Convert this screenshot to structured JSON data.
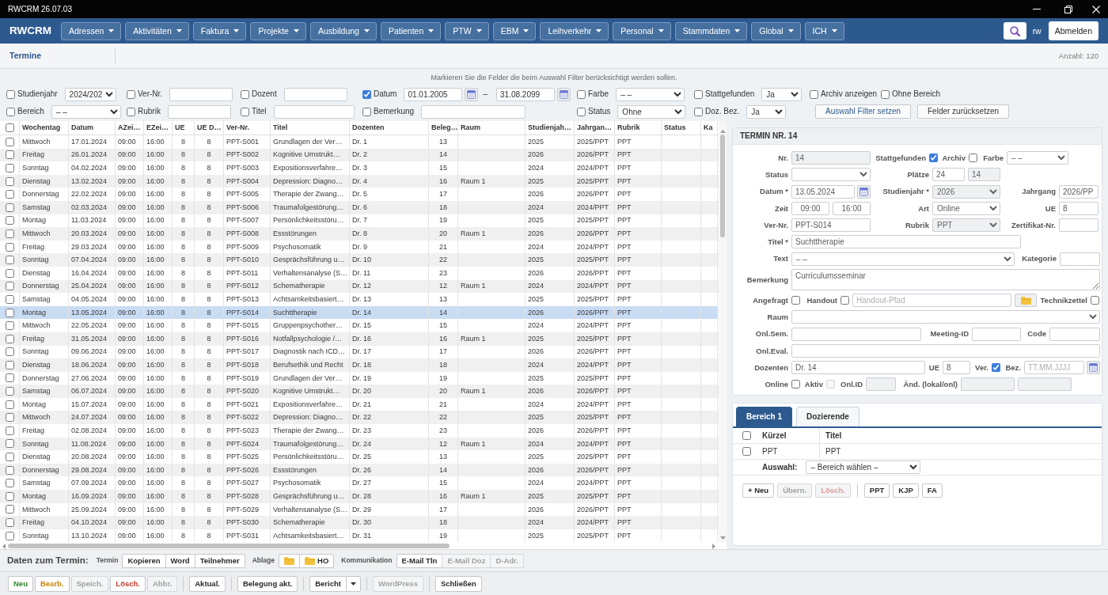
{
  "window": {
    "title": "RWCRM 26.07.03"
  },
  "navbar": {
    "brand": "RWCRM",
    "menus": [
      "Adressen",
      "Aktivitäten",
      "Faktura",
      "Projekte",
      "Ausbildung",
      "Patienten",
      "PTW",
      "EBM",
      "Leihverkehr",
      "Personal",
      "Stammdaten",
      "Global",
      "ICH"
    ],
    "user": "rw",
    "logout": "Abmelden"
  },
  "page": {
    "title": "Termine",
    "count": "Anzahl: 120"
  },
  "filter": {
    "hint": "Markieren Sie die Felder die beim Auswahl Filter berücksichtigt werden sollen.",
    "rows": [
      [
        {
          "kind": "select",
          "label": "Studienjahr",
          "checked": false,
          "value": "2024/202"
        },
        {
          "kind": "input",
          "label": "Ver-Nr.",
          "checked": false
        },
        {
          "kind": "input",
          "label": "Dozent",
          "checked": false
        },
        {
          "kind": "date_range",
          "label": "Datum",
          "checked": true,
          "from": "01.01.2005",
          "separator": "–",
          "to": "31.08.2099"
        },
        {
          "kind": "select",
          "label": "Farbe",
          "checked": false,
          "value": "– –"
        },
        {
          "kind": "select",
          "label": "Stattgefunden",
          "checked": false,
          "value": "Ja"
        },
        {
          "kind": "check",
          "label": "Archiv anzeigen",
          "checked": false
        },
        {
          "kind": "check",
          "label": "Ohne Bereich",
          "checked": false
        }
      ],
      [
        {
          "kind": "select",
          "label": "Bereich",
          "checked": false,
          "value": "– –"
        },
        {
          "kind": "input",
          "label": "Rubrik",
          "checked": false
        },
        {
          "kind": "input",
          "label": "Titel",
          "checked": false
        },
        {
          "kind": "input",
          "label": "Bemerkung",
          "checked": false
        },
        {
          "kind": "select",
          "label": "Status",
          "checked": false,
          "value": "Ohne"
        },
        {
          "kind": "select",
          "label": "Doz. Bez.",
          "checked": false,
          "value": "Ja"
        },
        {
          "kind": "button",
          "label": "Auswahl Filter setzen",
          "primary": true
        },
        {
          "kind": "button",
          "label": "Felder zurücksetzen",
          "primary": false
        }
      ]
    ]
  },
  "table": {
    "all_checked": false,
    "columns": [
      "Wochentag",
      "Datum",
      "AZei…",
      "EZei…",
      "UE",
      "UE D…",
      "Ver-Nr.",
      "Titel",
      "Dozenten",
      "Beleg…",
      "Raum",
      "Studienjah…",
      "Jahrgan…",
      "Rubrik",
      "Status",
      "Ka"
    ],
    "rows": [
      {
        "checked": false,
        "selected": false,
        "weekday": "Mittwoch",
        "date": "17.01.2024",
        "start": "09:00",
        "end": "16:00",
        "ue": "8",
        "ue_d": "8",
        "number": "PPT-S001",
        "title": "Grundlagen der Ver…",
        "lecturer": "Dr. 1",
        "booked": "13",
        "study_year": "2025",
        "cohort": "2025/PPT",
        "rubric": "PPT"
      },
      {
        "checked": false,
        "selected": false,
        "weekday": "Freitag",
        "date": "26.01.2024",
        "start": "09:00",
        "end": "16:00",
        "ue": "8",
        "ue_d": "8",
        "number": "PPT-S002",
        "title": "Kognitive Umstrukt…",
        "lecturer": "Dr. 2",
        "booked": "14",
        "study_year": "2026",
        "cohort": "2026/PPT",
        "rubric": "PPT"
      },
      {
        "checked": false,
        "selected": false,
        "weekday": "Sonntag",
        "date": "04.02.2024",
        "start": "09:00",
        "end": "16:00",
        "ue": "8",
        "ue_d": "8",
        "number": "PPT-S003",
        "title": "Expositionsverfahre…",
        "lecturer": "Dr. 3",
        "booked": "15",
        "study_year": "2024",
        "cohort": "2024/PPT",
        "rubric": "PPT"
      },
      {
        "checked": false,
        "selected": false,
        "weekday": "Dienstag",
        "date": "13.02.2024",
        "start": "09:00",
        "end": "16:00",
        "ue": "8",
        "ue_d": "8",
        "number": "PPT-S004",
        "title": "Depression: Diagno…",
        "lecturer": "Dr. 4",
        "booked": "16",
        "room": "Raum 1",
        "study_year": "2025",
        "cohort": "2025/PPT",
        "rubric": "PPT"
      },
      {
        "checked": false,
        "selected": false,
        "weekday": "Donnerstag",
        "date": "22.02.2024",
        "start": "09:00",
        "end": "16:00",
        "ue": "8",
        "ue_d": "8",
        "number": "PPT-S005",
        "title": "Therapie der Zwang…",
        "lecturer": "Dr. 5",
        "booked": "17",
        "study_year": "2026",
        "cohort": "2026/PPT",
        "rubric": "PPT"
      },
      {
        "checked": false,
        "selected": false,
        "weekday": "Samstag",
        "date": "02.03.2024",
        "start": "09:00",
        "end": "16:00",
        "ue": "8",
        "ue_d": "8",
        "number": "PPT-S006",
        "title": "Traumafolgestörung…",
        "lecturer": "Dr. 6",
        "booked": "18",
        "study_year": "2024",
        "cohort": "2024/PPT",
        "rubric": "PPT"
      },
      {
        "checked": false,
        "selected": false,
        "weekday": "Montag",
        "date": "11.03.2024",
        "start": "09:00",
        "end": "16:00",
        "ue": "8",
        "ue_d": "8",
        "number": "PPT-S007",
        "title": "Persönlichkeitsstöru…",
        "lecturer": "Dr. 7",
        "booked": "19",
        "study_year": "2025",
        "cohort": "2025/PPT",
        "rubric": "PPT"
      },
      {
        "checked": false,
        "selected": false,
        "weekday": "Mittwoch",
        "date": "20.03.2024",
        "start": "09:00",
        "end": "16:00",
        "ue": "8",
        "ue_d": "8",
        "number": "PPT-S008",
        "title": "Essstörungen",
        "lecturer": "Dr. 8",
        "booked": "20",
        "room": "Raum 1",
        "study_year": "2026",
        "cohort": "2026/PPT",
        "rubric": "PPT"
      },
      {
        "checked": false,
        "selected": false,
        "weekday": "Freitag",
        "date": "29.03.2024",
        "start": "09:00",
        "end": "16:00",
        "ue": "8",
        "ue_d": "8",
        "number": "PPT-S009",
        "title": "Psychosomatik",
        "lecturer": "Dr. 9",
        "booked": "21",
        "study_year": "2024",
        "cohort": "2024/PPT",
        "rubric": "PPT"
      },
      {
        "checked": false,
        "selected": false,
        "weekday": "Sonntag",
        "date": "07.04.2024",
        "start": "09:00",
        "end": "16:00",
        "ue": "8",
        "ue_d": "8",
        "number": "PPT-S010",
        "title": "Gesprächsführung u…",
        "lecturer": "Dr. 10",
        "booked": "22",
        "study_year": "2025",
        "cohort": "2025/PPT",
        "rubric": "PPT"
      },
      {
        "checked": false,
        "selected": false,
        "weekday": "Dienstag",
        "date": "16.04.2024",
        "start": "09:00",
        "end": "16:00",
        "ue": "8",
        "ue_d": "8",
        "number": "PPT-S011",
        "title": "Verhaltensanalyse (S…",
        "lecturer": "Dr. 11",
        "booked": "23",
        "study_year": "2026",
        "cohort": "2026/PPT",
        "rubric": "PPT"
      },
      {
        "checked": false,
        "selected": false,
        "weekday": "Donnerstag",
        "date": "25.04.2024",
        "start": "09:00",
        "end": "16:00",
        "ue": "8",
        "ue_d": "8",
        "number": "PPT-S012",
        "title": "Schematherapie",
        "lecturer": "Dr. 12",
        "booked": "12",
        "room": "Raum 1",
        "study_year": "2024",
        "cohort": "2024/PPT",
        "rubric": "PPT"
      },
      {
        "checked": false,
        "selected": false,
        "weekday": "Samstag",
        "date": "04.05.2024",
        "start": "09:00",
        "end": "16:00",
        "ue": "8",
        "ue_d": "8",
        "number": "PPT-S013",
        "title": "Achtsamkeitsbasiert…",
        "lecturer": "Dr. 13",
        "booked": "13",
        "study_year": "2025",
        "cohort": "2025/PPT",
        "rubric": "PPT"
      },
      {
        "checked": false,
        "selected": true,
        "weekday": "Montag",
        "date": "13.05.2024",
        "start": "09:00",
        "end": "16:00",
        "ue": "8",
        "ue_d": "8",
        "number": "PPT-S014",
        "title": "Suchttherapie",
        "lecturer": "Dr. 14",
        "booked": "14",
        "study_year": "2026",
        "cohort": "2026/PPT",
        "rubric": "PPT"
      },
      {
        "checked": false,
        "selected": false,
        "weekday": "Mittwoch",
        "date": "22.05.2024",
        "start": "09:00",
        "end": "16:00",
        "ue": "8",
        "ue_d": "8",
        "number": "PPT-S015",
        "title": "Gruppenpsychother…",
        "lecturer": "Dr. 15",
        "booked": "15",
        "study_year": "2024",
        "cohort": "2024/PPT",
        "rubric": "PPT"
      },
      {
        "checked": false,
        "selected": false,
        "weekday": "Freitag",
        "date": "31.05.2024",
        "start": "09:00",
        "end": "16:00",
        "ue": "8",
        "ue_d": "8",
        "number": "PPT-S016",
        "title": "Notfallpsychologie /…",
        "lecturer": "Dr. 16",
        "booked": "16",
        "room": "Raum 1",
        "study_year": "2025",
        "cohort": "2025/PPT",
        "rubric": "PPT"
      },
      {
        "checked": false,
        "selected": false,
        "weekday": "Sonntag",
        "date": "09.06.2024",
        "start": "09:00",
        "end": "16:00",
        "ue": "8",
        "ue_d": "8",
        "number": "PPT-S017",
        "title": "Diagnostik nach ICD…",
        "lecturer": "Dr. 17",
        "booked": "17",
        "study_year": "2026",
        "cohort": "2026/PPT",
        "rubric": "PPT"
      },
      {
        "checked": false,
        "selected": false,
        "weekday": "Dienstag",
        "date": "18.06.2024",
        "start": "09:00",
        "end": "16:00",
        "ue": "8",
        "ue_d": "8",
        "number": "PPT-S018",
        "title": "Berufsethik und Recht",
        "lecturer": "Dr. 18",
        "booked": "18",
        "study_year": "2024",
        "cohort": "2024/PPT",
        "rubric": "PPT"
      },
      {
        "checked": false,
        "selected": false,
        "weekday": "Donnerstag",
        "date": "27.06.2024",
        "start": "09:00",
        "end": "16:00",
        "ue": "8",
        "ue_d": "8",
        "number": "PPT-S019",
        "title": "Grundlagen der Ver…",
        "lecturer": "Dr. 19",
        "booked": "19",
        "study_year": "2025",
        "cohort": "2025/PPT",
        "rubric": "PPT"
      },
      {
        "checked": false,
        "selected": false,
        "weekday": "Samstag",
        "date": "06.07.2024",
        "start": "09:00",
        "end": "16:00",
        "ue": "8",
        "ue_d": "8",
        "number": "PPT-S020",
        "title": "Kognitive Umstrukt…",
        "lecturer": "Dr. 20",
        "booked": "20",
        "room": "Raum 1",
        "study_year": "2026",
        "cohort": "2026/PPT",
        "rubric": "PPT"
      },
      {
        "checked": false,
        "selected": false,
        "weekday": "Montag",
        "date": "15.07.2024",
        "start": "09:00",
        "end": "16:00",
        "ue": "8",
        "ue_d": "8",
        "number": "PPT-S021",
        "title": "Expositionsverfahre…",
        "lecturer": "Dr. 21",
        "booked": "21",
        "study_year": "2024",
        "cohort": "2024/PPT",
        "rubric": "PPT"
      },
      {
        "checked": false,
        "selected": false,
        "weekday": "Mittwoch",
        "date": "24.07.2024",
        "start": "09:00",
        "end": "16:00",
        "ue": "8",
        "ue_d": "8",
        "number": "PPT-S022",
        "title": "Depression: Diagno…",
        "lecturer": "Dr. 22",
        "booked": "22",
        "study_year": "2025",
        "cohort": "2025/PPT",
        "rubric": "PPT"
      },
      {
        "checked": false,
        "selected": false,
        "weekday": "Freitag",
        "date": "02.08.2024",
        "start": "09:00",
        "end": "16:00",
        "ue": "8",
        "ue_d": "8",
        "number": "PPT-S023",
        "title": "Therapie der Zwang…",
        "lecturer": "Dr. 23",
        "booked": "23",
        "study_year": "2026",
        "cohort": "2026/PPT",
        "rubric": "PPT"
      },
      {
        "checked": false,
        "selected": false,
        "weekday": "Sonntag",
        "date": "11.08.2024",
        "start": "09:00",
        "end": "16:00",
        "ue": "8",
        "ue_d": "8",
        "number": "PPT-S024",
        "title": "Traumafolgestörung…",
        "lecturer": "Dr. 24",
        "booked": "12",
        "room": "Raum 1",
        "study_year": "2024",
        "cohort": "2024/PPT",
        "rubric": "PPT"
      },
      {
        "checked": false,
        "selected": false,
        "weekday": "Dienstag",
        "date": "20.08.2024",
        "start": "09:00",
        "end": "16:00",
        "ue": "8",
        "ue_d": "8",
        "number": "PPT-S025",
        "title": "Persönlichkeitsstöru…",
        "lecturer": "Dr. 25",
        "booked": "13",
        "study_year": "2025",
        "cohort": "2025/PPT",
        "rubric": "PPT"
      },
      {
        "checked": false,
        "selected": false,
        "weekday": "Donnerstag",
        "date": "29.08.2024",
        "start": "09:00",
        "end": "16:00",
        "ue": "8",
        "ue_d": "8",
        "number": "PPT-S026",
        "title": "Essstörungen",
        "lecturer": "Dr. 26",
        "booked": "14",
        "study_year": "2026",
        "cohort": "2026/PPT",
        "rubric": "PPT"
      },
      {
        "checked": false,
        "selected": false,
        "weekday": "Samstag",
        "date": "07.09.2024",
        "start": "09:00",
        "end": "16:00",
        "ue": "8",
        "ue_d": "8",
        "number": "PPT-S027",
        "title": "Psychosomatik",
        "lecturer": "Dr. 27",
        "booked": "15",
        "study_year": "2024",
        "cohort": "2024/PPT",
        "rubric": "PPT"
      },
      {
        "checked": false,
        "selected": false,
        "weekday": "Montag",
        "date": "16.09.2024",
        "start": "09:00",
        "end": "16:00",
        "ue": "8",
        "ue_d": "8",
        "number": "PPT-S028",
        "title": "Gesprächsführung u…",
        "lecturer": "Dr. 28",
        "booked": "16",
        "room": "Raum 1",
        "study_year": "2025",
        "cohort": "2025/PPT",
        "rubric": "PPT"
      },
      {
        "checked": false,
        "selected": false,
        "weekday": "Mittwoch",
        "date": "25.09.2024",
        "start": "09:00",
        "end": "16:00",
        "ue": "8",
        "ue_d": "8",
        "number": "PPT-S029",
        "title": "Verhaltensanalyse (S…",
        "lecturer": "Dr. 29",
        "booked": "17",
        "study_year": "2026",
        "cohort": "2026/PPT",
        "rubric": "PPT"
      },
      {
        "checked": false,
        "selected": false,
        "weekday": "Freitag",
        "date": "04.10.2024",
        "start": "09:00",
        "end": "16:00",
        "ue": "8",
        "ue_d": "8",
        "number": "PPT-S030",
        "title": "Schematherapie",
        "lecturer": "Dr. 30",
        "booked": "18",
        "study_year": "2024",
        "cohort": "2024/PPT",
        "rubric": "PPT"
      },
      {
        "checked": false,
        "selected": false,
        "weekday": "Sonntag",
        "date": "13.10.2024",
        "start": "09:00",
        "end": "16:00",
        "ue": "8",
        "ue_d": "8",
        "number": "PPT-S031",
        "title": "Achtsamkeitsbasiert…",
        "lecturer": "Dr. 31",
        "booked": "19",
        "study_year": "2025",
        "cohort": "2025/PPT",
        "rubric": "PPT"
      }
    ]
  },
  "detail": {
    "title": "TERMIN NR. 14",
    "lines": [
      [
        {
          "label": "Nr.",
          "controls": [
            {
              "kind": "input",
              "value": "14",
              "disabled": true
            }
          ]
        },
        {
          "label": "Stattgefunden",
          "controls": [
            {
              "kind": "check",
              "checked": true,
              "disabled": false
            }
          ]
        },
        {
          "label": "Archiv",
          "controls": [
            {
              "kind": "check",
              "checked": false,
              "disabled": false
            }
          ]
        },
        {
          "label": "Farbe",
          "controls": [
            {
              "kind": "select",
              "value": "– –",
              "disabled": false
            }
          ]
        }
      ],
      [
        {
          "label": "Status",
          "controls": [
            {
              "kind": "select",
              "disabled": false
            }
          ]
        },
        {
          "label": "Plätze",
          "controls": [
            {
              "kind": "input",
              "value": "24",
              "disabled": false
            },
            {
              "kind": "input",
              "value": "14",
              "disabled": true
            }
          ]
        }
      ],
      [
        {
          "label": "Datum *",
          "controls": [
            {
              "kind": "date",
              "value": "13.05.2024",
              "disabled": false
            }
          ]
        },
        {
          "label": "Studienjahr *",
          "controls": [
            {
              "kind": "select",
              "value": "2026",
              "disabled": true
            }
          ]
        },
        {
          "label": "Jahrgang",
          "controls": [
            {
              "kind": "input",
              "value": "2026/PP",
              "disabled": false
            }
          ]
        }
      ],
      [
        {
          "label": "Zeit",
          "controls": [
            {
              "kind": "time",
              "value": "09:00",
              "disabled": false
            },
            {
              "kind": "time",
              "value": "16:00",
              "disabled": false
            }
          ]
        },
        {
          "label": "Art",
          "controls": [
            {
              "kind": "select",
              "value": "Online",
              "disabled": false
            }
          ]
        },
        {
          "label": "UE",
          "controls": [
            {
              "kind": "input",
              "value": "8",
              "disabled": false
            }
          ]
        }
      ],
      [
        {
          "label": "Ver-Nr.",
          "controls": [
            {
              "kind": "input",
              "value": "PPT-S014",
              "disabled": false
            }
          ]
        },
        {
          "label": "Rubrik",
          "controls": [
            {
              "kind": "select",
              "value": "PPT",
              "disabled": true
            }
          ]
        },
        {
          "label": "Zertifikat-Nr.",
          "controls": [
            {
              "kind": "input",
              "disabled": false
            }
          ]
        }
      ],
      [
        {
          "label": "Titel *",
          "controls": [
            {
              "kind": "input",
              "value": "Suchttherapie",
              "disabled": false
            }
          ]
        }
      ],
      [
        {
          "label": "Text",
          "controls": [
            {
              "kind": "select",
              "value": "– –",
              "disabled": false
            }
          ]
        },
        {
          "label": "Kategorie",
          "controls": [
            {
              "kind": "input",
              "disabled": false
            }
          ]
        }
      ],
      [
        {
          "label": "Bemerkung",
          "controls": [
            {
              "kind": "textarea",
              "value": "Curriculumsseminar",
              "disabled": false
            }
          ]
        }
      ],
      [
        {
          "label": "Angefragt",
          "controls": [
            {
              "kind": "check",
              "checked": false,
              "disabled": false
            }
          ]
        },
        {
          "label": "Handout",
          "controls": [
            {
              "kind": "check",
              "checked": false,
              "disabled": false
            },
            {
              "kind": "input",
              "placeholder": "Handout-Pfad",
              "disabled": false
            },
            {
              "kind": "folder",
              "disabled": false
            }
          ]
        },
        {
          "label": "Technikzettel",
          "controls": [
            {
              "kind": "check",
              "checked": false,
              "disabled": false
            }
          ]
        }
      ],
      [
        {
          "label": "Raum",
          "controls": [
            {
              "kind": "select",
              "disabled": false
            }
          ]
        }
      ],
      [
        {
          "label": "Onl.Sem.",
          "controls": [
            {
              "kind": "input",
              "disabled": false
            }
          ]
        },
        {
          "label": "Meeting-ID",
          "controls": [
            {
              "kind": "input",
              "disabled": false
            }
          ]
        },
        {
          "label": "Code",
          "controls": [
            {
              "kind": "input",
              "disabled": false
            }
          ]
        }
      ],
      [
        {
          "label": "Onl.Eval.",
          "controls": [
            {
              "kind": "input",
              "disabled": false
            }
          ]
        }
      ],
      [
        {
          "label": "Dozenten",
          "controls": [
            {
              "kind": "input",
              "value": "Dr. 14",
              "disabled": false
            }
          ]
        },
        {
          "label": "UE",
          "controls": [
            {
              "kind": "input",
              "value": "8",
              "disabled": false
            }
          ]
        },
        {
          "label": "Ver.",
          "controls": [
            {
              "kind": "check",
              "checked": true,
              "disabled": false
            }
          ]
        },
        {
          "label": "Bez.",
          "controls": [
            {
              "kind": "date",
              "placeholder": "TT.MM.JJJJ",
              "disabled": false
            }
          ]
        }
      ],
      [
        {
          "label": "Online",
          "controls": [
            {
              "kind": "check",
              "checked": false,
              "disabled": false
            }
          ]
        },
        {
          "label": "Aktiv",
          "controls": [
            {
              "kind": "check",
              "checked": false,
              "disabled": true
            }
          ]
        },
        {
          "label": "Onl.ID",
          "controls": [
            {
              "kind": "input",
              "disabled": true
            }
          ]
        },
        {
          "label": "Änd. (lokal/onl)",
          "controls": [
            {
              "kind": "input",
              "disabled": true
            },
            {
              "kind": "input",
              "disabled": true
            }
          ]
        }
      ]
    ]
  },
  "bereich": {
    "tabs": [
      {
        "label": "Bereich 1",
        "selected": true
      },
      {
        "label": "Dozierende",
        "selected": false
      }
    ],
    "all_checked": false,
    "columns": [
      "Kürzel",
      "Titel"
    ],
    "rows": [
      {
        "checked": false,
        "cells": [
          "PPT",
          "PPT"
        ]
      }
    ],
    "selection": {
      "label": "Auswahl:",
      "value": "– Bereich wählen –"
    },
    "buttons": [
      [
        {
          "label": "+ Neu",
          "disabled": false
        },
        {
          "label": "Übern.",
          "disabled": true
        },
        {
          "label": "Lösch.",
          "color": "#e39a9a",
          "disabled": true
        }
      ],
      [
        {
          "label": "PPT",
          "disabled": false
        },
        {
          "label": "KJP",
          "disabled": false
        },
        {
          "label": "FA",
          "disabled": false
        }
      ]
    ]
  },
  "record_bar": {
    "title": "Daten zum Termin:",
    "groups": [
      {
        "label": "Termin",
        "buttons": [
          {
            "kind": "text",
            "label": "Kopieren",
            "disabled": false
          },
          {
            "kind": "text",
            "label": "Word",
            "disabled": false
          },
          {
            "kind": "text",
            "label": "Teilnehmer",
            "disabled": false
          }
        ]
      },
      {
        "label": "Ablage",
        "buttons": [
          {
            "kind": "folder",
            "disabled": false
          },
          {
            "kind": "folder",
            "label": "HO",
            "disabled": false
          }
        ]
      },
      {
        "label": "Kommunikation",
        "buttons": [
          {
            "kind": "text",
            "label": "E-Mail Tln",
            "disabled": false
          },
          {
            "kind": "text",
            "label": "E-Mail Doz",
            "disabled": true
          },
          {
            "kind": "text",
            "label": "D-Adr.",
            "disabled": true
          }
        ]
      }
    ]
  },
  "actions": [
    [
      {
        "label": "Neu",
        "color": "#2b8a2b",
        "disabled": false
      },
      {
        "label": "Bearb.",
        "color": "#c7870f",
        "disabled": false
      },
      {
        "label": "Speich.",
        "disabled": true
      },
      {
        "label": "Lösch.",
        "color": "#c0392b",
        "disabled": false
      },
      {
        "label": "Abbr.",
        "disabled": true
      }
    ],
    [
      {
        "label": "Aktual.",
        "disabled": false
      }
    ],
    [
      {
        "label": "Belegung akt.",
        "disabled": false
      }
    ],
    [
      {
        "label": "Bericht",
        "disabled": false,
        "split": true
      }
    ],
    [
      {
        "label": "WordPress",
        "disabled": true
      }
    ],
    [
      {
        "label": "Schließen",
        "disabled": false
      }
    ]
  ]
}
